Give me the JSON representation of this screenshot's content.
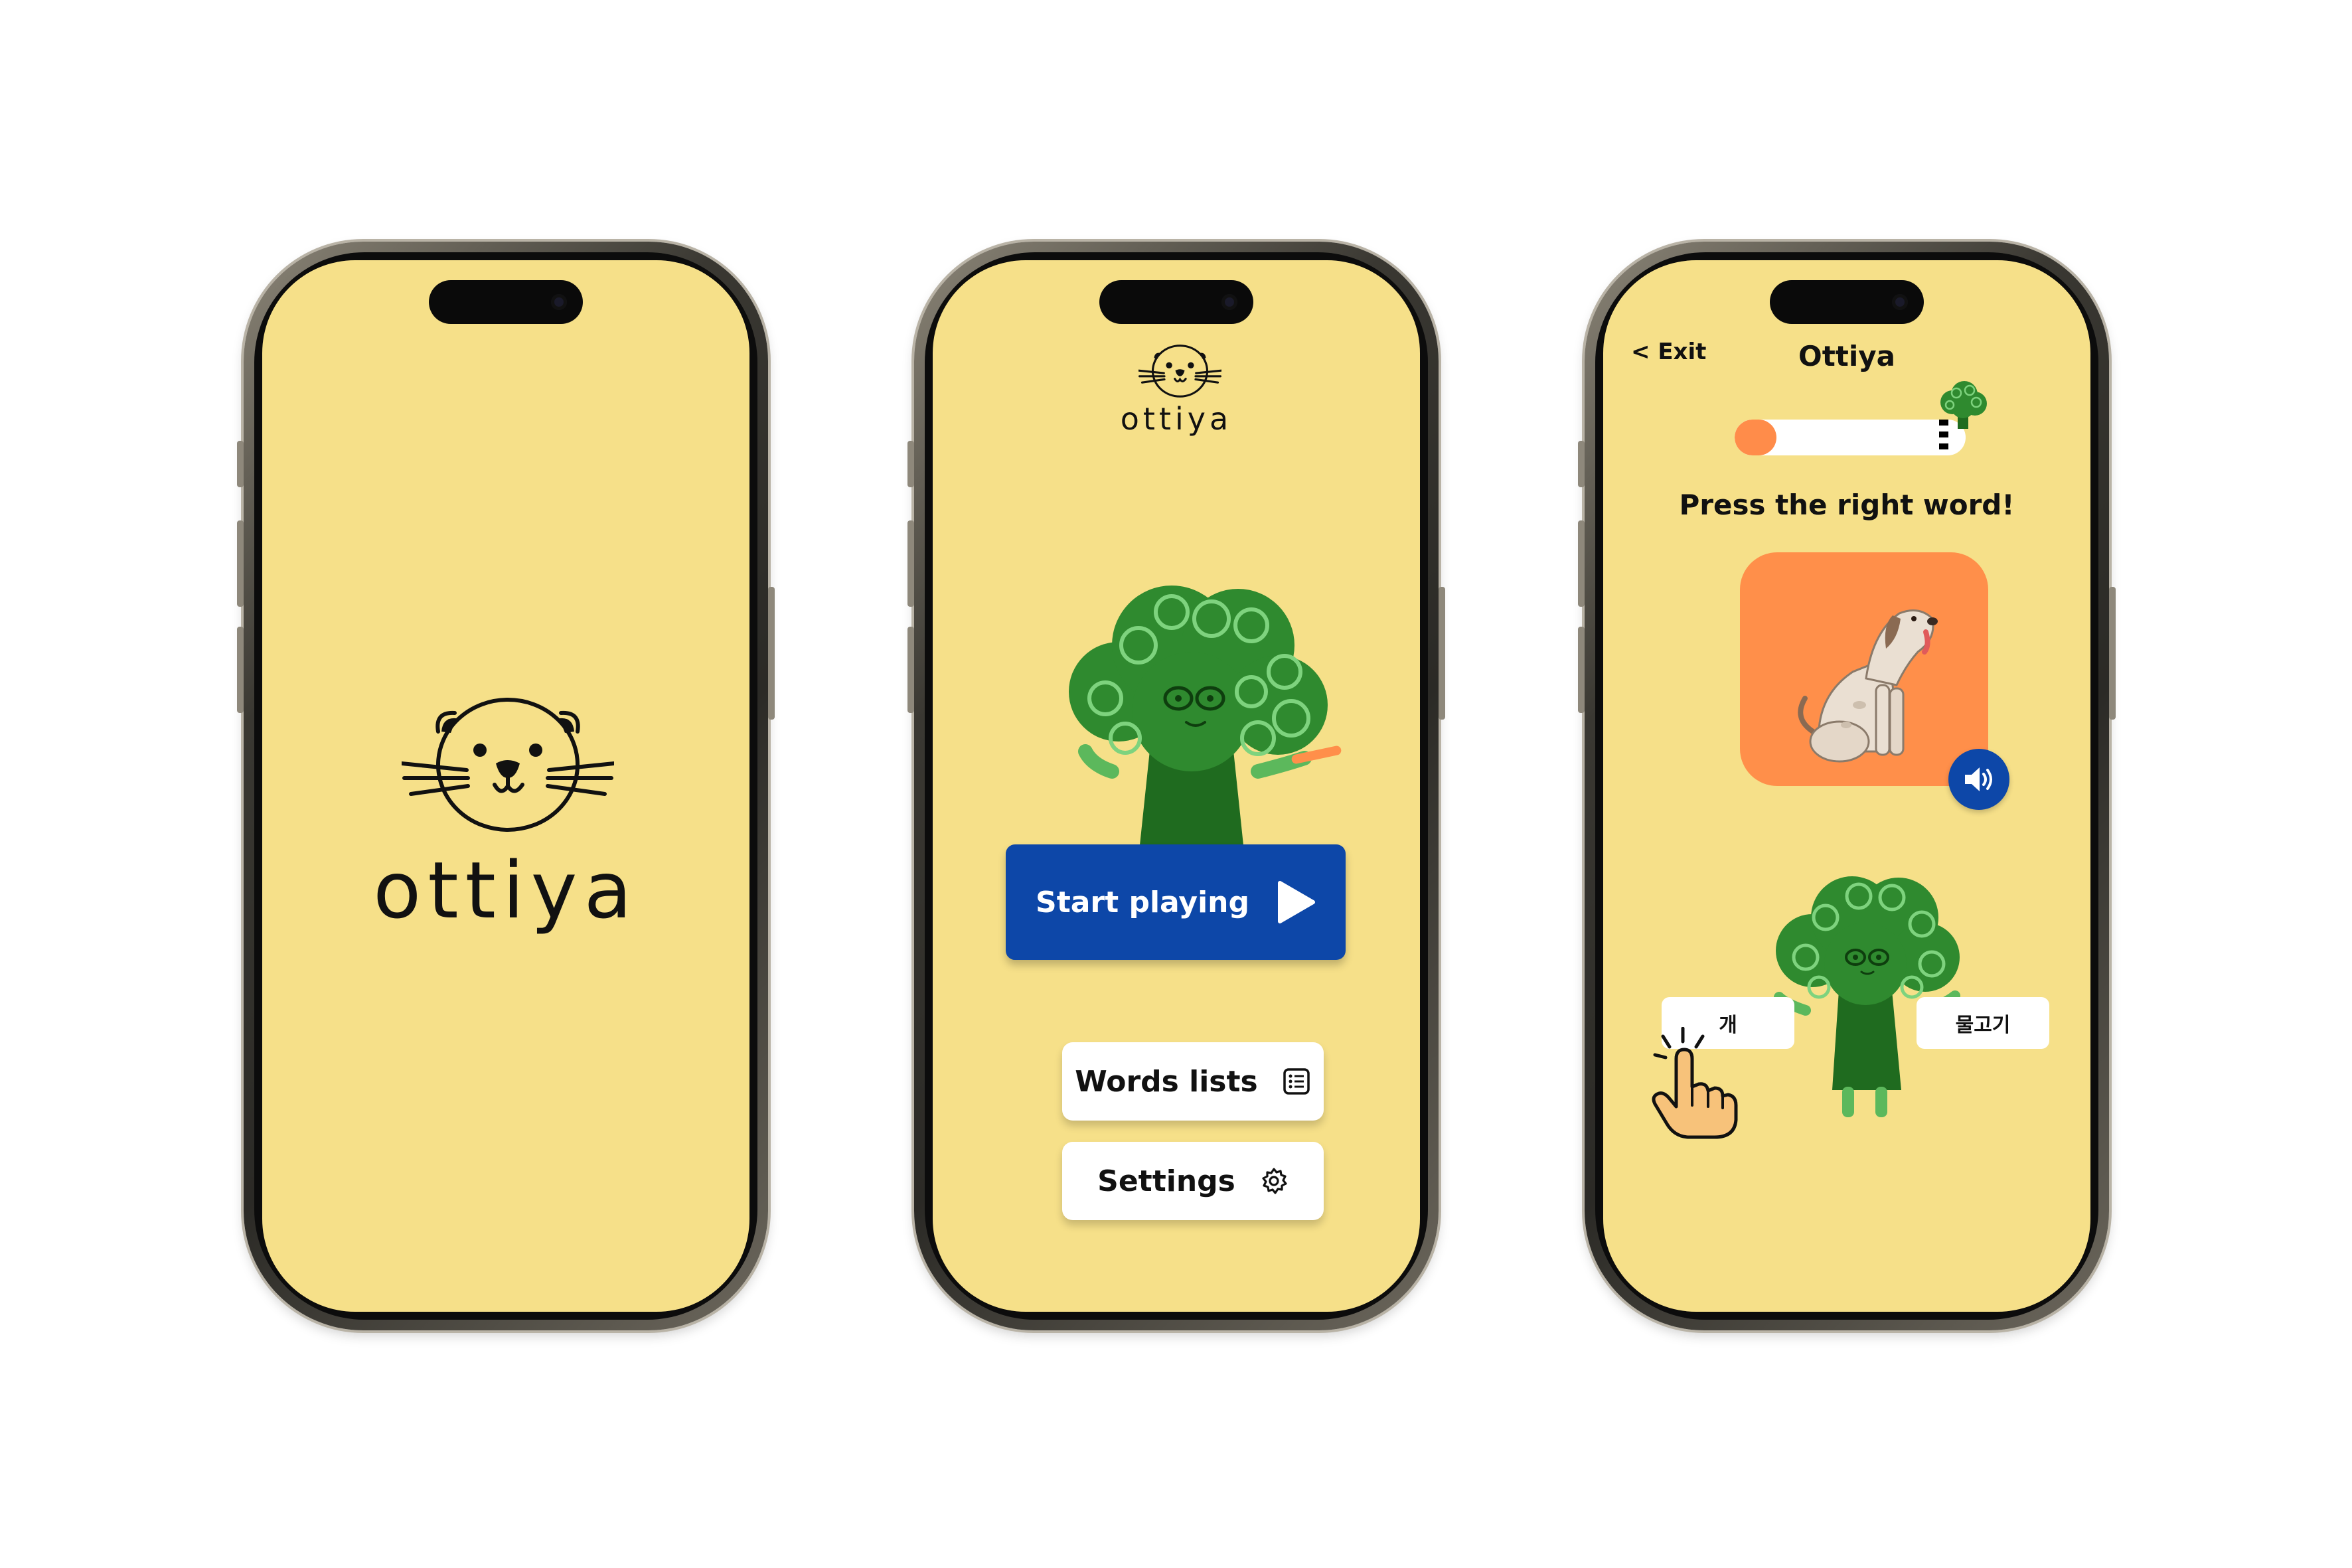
{
  "colors": {
    "screen_bg": "#f6e089",
    "primary_blue": "#0d47a8",
    "accent_orange": "#ff8f4a",
    "mascot_green": "#2e7d32"
  },
  "splash_screen": {
    "brand_name": "ottiya",
    "logo_icon": "otter-face-icon"
  },
  "home_screen": {
    "brand_name": "ottiya",
    "start_button": "Start playing",
    "start_icon": "play-icon",
    "words_lists_button": "Words lists",
    "words_lists_icon": "list-icon",
    "settings_button": "Settings",
    "settings_icon": "gear-icon",
    "mascot": "broccoli-mascot"
  },
  "game_screen": {
    "exit_label": "< Exit",
    "title": "Ottiya",
    "progress": 0.18,
    "instruction": "Press the right word!",
    "picture": "dog-illustration",
    "sound_icon": "speaker-icon",
    "answers": [
      "개",
      "물고기"
    ],
    "hand_icon": "pointing-hand-icon"
  }
}
